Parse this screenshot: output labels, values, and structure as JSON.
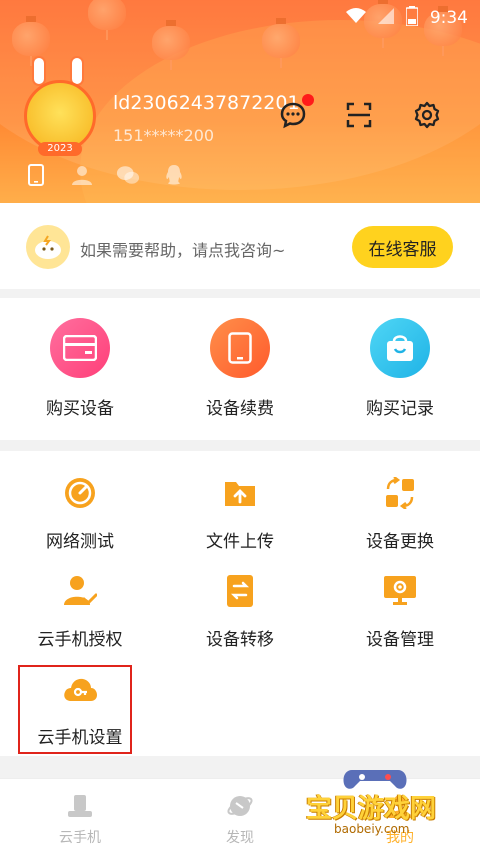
{
  "status_bar": {
    "time": "9:34",
    "icons": [
      "wifi-icon",
      "signal-icon",
      "battery-icon"
    ],
    "battery_level": "9"
  },
  "profile": {
    "avatar_badge": "2023",
    "username": "ld23062437872201",
    "phone": "151*****200",
    "header_actions": [
      "message-icon",
      "scan-icon",
      "settings-icon"
    ],
    "bind_icons": [
      "phone-icon",
      "contact-icon",
      "wechat-icon",
      "qq-icon"
    ]
  },
  "help": {
    "text": "如果需要帮助，请点我咨询~",
    "button": "在线客服"
  },
  "quick_actions": [
    {
      "label": "购买设备",
      "icon": "card-icon",
      "color": "#ff4f86"
    },
    {
      "label": "设备续费",
      "icon": "tablet-icon",
      "color": "#ff6d3b"
    },
    {
      "label": "购买记录",
      "icon": "bag-icon",
      "color": "#2ec5ef"
    }
  ],
  "tools": [
    {
      "label": "网络测试",
      "icon": "speedometer-icon"
    },
    {
      "label": "文件上传",
      "icon": "folder-upload-icon"
    },
    {
      "label": "设备更换",
      "icon": "swap-icon"
    },
    {
      "label": "云手机授权",
      "icon": "user-check-icon"
    },
    {
      "label": "设备转移",
      "icon": "transfer-icon"
    },
    {
      "label": "设备管理",
      "icon": "monitor-gear-icon"
    },
    {
      "label": "云手机设置",
      "icon": "cloud-key-icon"
    }
  ],
  "bottom_nav": [
    {
      "label": "云手机",
      "icon": "phone-stand-icon"
    },
    {
      "label": "发现",
      "icon": "planet-icon"
    },
    {
      "label": "",
      "icon": ""
    },
    {
      "label": "我的",
      "icon": "user-icon"
    }
  ],
  "watermark": {
    "text": "宝贝游戏网",
    "url": "baobeiy.com"
  },
  "colors": {
    "accent": "#ff7a2e",
    "button_yellow": "#ffd21e",
    "tool_orange": "#f7a21e",
    "highlight_red": "#e0241b"
  }
}
